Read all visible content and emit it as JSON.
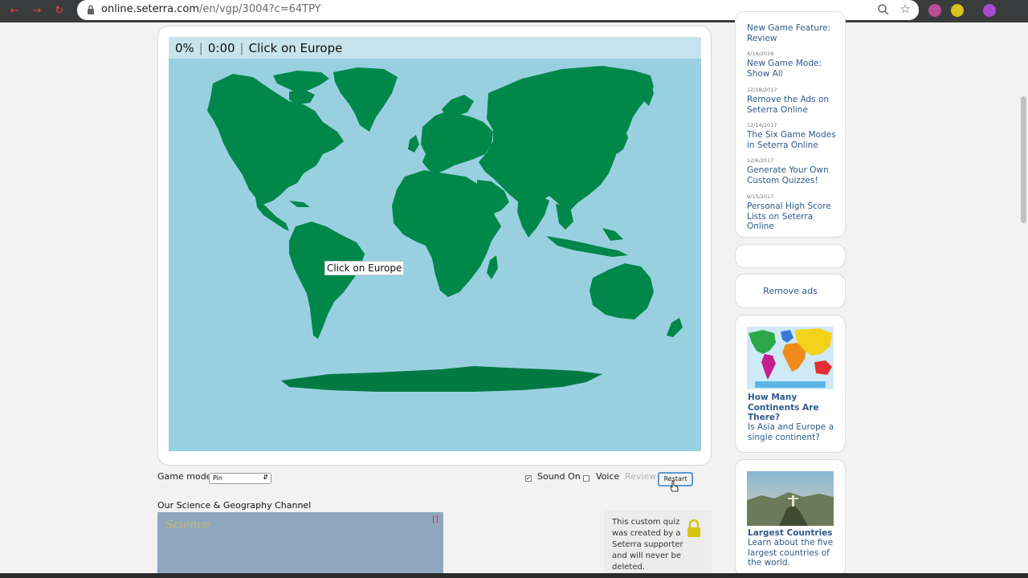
{
  "browser": {
    "url_host": "online.seterra.com",
    "url_path": "/en/vgp/3004?c=64TPY"
  },
  "game": {
    "progress": "0%",
    "timer": "0:00",
    "prompt": "Click on Europe",
    "tooltip": "Click on Europe"
  },
  "controls": {
    "game_mode_label": "Game mode:",
    "game_mode_value": "Pin",
    "sound_label": "Sound On",
    "sound_checked": true,
    "voice_label": "Voice",
    "voice_checked": false,
    "review_label": "Review",
    "restart_label": "Restart"
  },
  "channel": {
    "title": "Our Science & Geography Channel",
    "video_text": "Science",
    "corner_mark": "[]"
  },
  "quiz_note": {
    "text": "This custom quiz was created by a Seterra supporter and will never be deleted."
  },
  "news": [
    {
      "date": "",
      "title": "New Game Feature: Review"
    },
    {
      "date": "4/16/2018",
      "title": "New Game Mode: Show All"
    },
    {
      "date": "12/18/2017",
      "title": "Remove the Ads on Seterra Online"
    },
    {
      "date": "12/14/2017",
      "title": "The Six Game Modes in Seterra Online"
    },
    {
      "date": "12/6/2017",
      "title": "Generate Your Own Custom Quizzes!"
    },
    {
      "date": "9/15/2017",
      "title": "Personal High Score Lists on Seterra Online"
    }
  ],
  "sidebar": {
    "remove_ads": "Remove ads",
    "promo1_title": "How Many Continents Are There?",
    "promo1_desc": "Is Asia and Europe a single continent?",
    "promo2_title": "Largest Countries",
    "promo2_desc": "Learn about the five largest countries of the world."
  },
  "colors": {
    "land": "#00874a",
    "ocean": "#99d0e0",
    "link": "#2d5b8c"
  }
}
